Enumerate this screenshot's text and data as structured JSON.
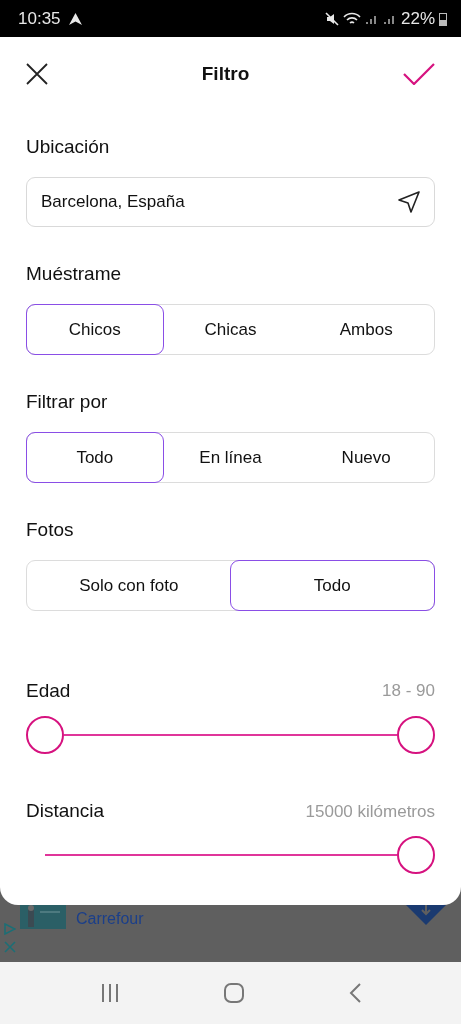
{
  "status_bar": {
    "time": "10:35",
    "battery": "22%"
  },
  "header": {
    "title": "Filtro"
  },
  "location": {
    "label": "Ubicación",
    "value": "Barcelona, España"
  },
  "segments": [
    {
      "label": "Muéstrame",
      "options": [
        {
          "label": "Chicos",
          "selected": true
        },
        {
          "label": "Chicas",
          "selected": false
        },
        {
          "label": "Ambos",
          "selected": false
        }
      ]
    },
    {
      "label": "Filtrar por",
      "options": [
        {
          "label": "Todo",
          "selected": true
        },
        {
          "label": "En línea",
          "selected": false
        },
        {
          "label": "Nuevo",
          "selected": false
        }
      ]
    },
    {
      "label": "Fotos",
      "options": [
        {
          "label": "Solo con foto",
          "selected": false
        },
        {
          "label": "Todo",
          "selected": true
        }
      ]
    }
  ],
  "sliders": [
    {
      "kind": "range",
      "label": "Edad",
      "reading": "18 - 90"
    },
    {
      "kind": "single",
      "label": "Distancia",
      "reading": "15000 kilómetros"
    }
  ],
  "ad": {
    "advertiser": "Carrefour"
  }
}
